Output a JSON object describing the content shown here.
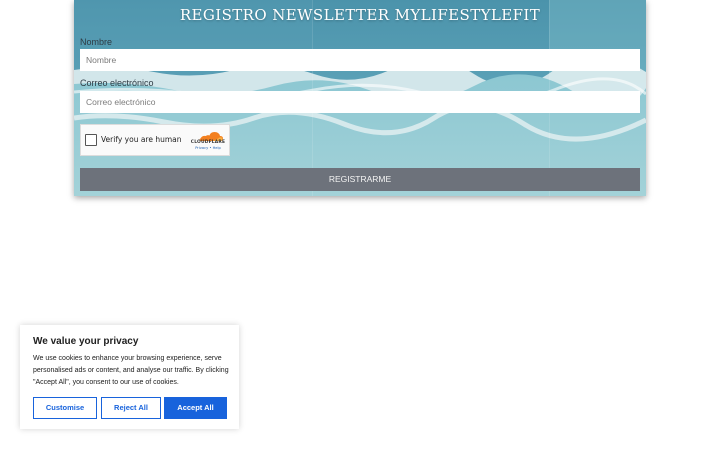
{
  "newsletter": {
    "title": "REGISTRO NEWSLETTER MYLIFESTYLEFIT",
    "name_label": "Nombre",
    "name_placeholder": "Nombre",
    "email_label": "Correo electrónico",
    "email_placeholder": "Correo electrónico",
    "submit_label": "REGISTRARME"
  },
  "captcha": {
    "label": "Verify you are human",
    "brand": "CLOUDFLARE",
    "links": "Privacy • Help"
  },
  "cookie_banner": {
    "title": "We value your privacy",
    "text": "We use cookies to enhance your browsing experience, serve personalised ads or content, and analyse our traffic. By clicking \"Accept All\", you consent to our use of cookies.",
    "customise_label": "Customise",
    "reject_label": "Reject All",
    "accept_label": "Accept All"
  },
  "colors": {
    "accent": "#1863dc",
    "submit_bg": "#6d727b",
    "sea": "#6fb2c4",
    "cloudflare": "#f38020"
  }
}
